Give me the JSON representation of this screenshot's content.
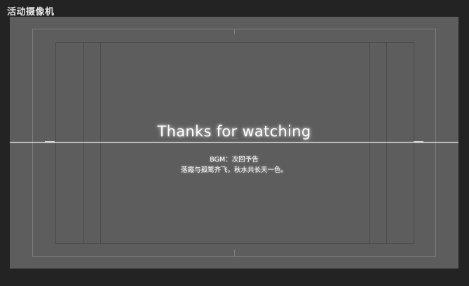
{
  "camera": {
    "label": "活动摄像机"
  },
  "overlay": {
    "title": "Thanks for watching",
    "bgm": "BGM：次回予告",
    "poem": "落霞与孤鹜齐飞，秋水共长天一色。"
  },
  "colors": {
    "background": "#232323",
    "viewport": "#5d5d5d",
    "text": "#ffffff"
  }
}
